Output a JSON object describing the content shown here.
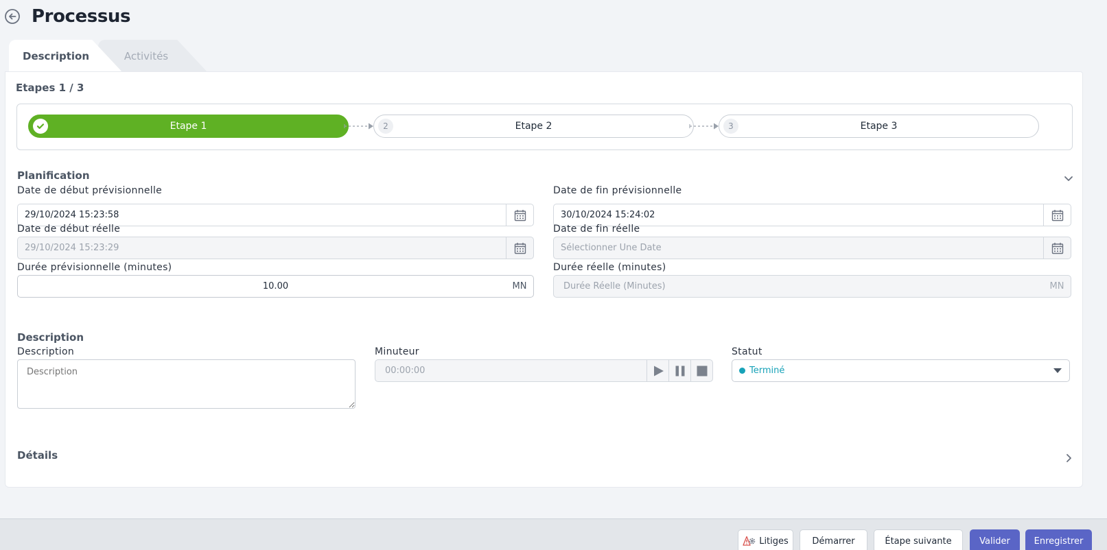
{
  "header": {
    "title": "Processus"
  },
  "tabs": [
    {
      "label": "Description"
    },
    {
      "label": "Activités"
    }
  ],
  "steps": {
    "heading": "Etapes 1 / 3",
    "items": [
      {
        "number": "1",
        "label": "Etape 1",
        "status": "done"
      },
      {
        "number": "2",
        "label": "Etape 2",
        "status": "todo"
      },
      {
        "number": "3",
        "label": "Etape 3",
        "status": "todo"
      }
    ]
  },
  "planning": {
    "heading": "Planification",
    "start_planned": {
      "label": "Date de début prévisionnelle",
      "value": "29/10/2024 15:23:58"
    },
    "end_planned": {
      "label": "Date de fin prévisionnelle",
      "value": "30/10/2024 15:24:02"
    },
    "start_actual": {
      "label": "Date de début réelle",
      "value": "29/10/2024 15:23:29"
    },
    "end_actual": {
      "label": "Date de fin réelle",
      "placeholder": "Sélectionner Une Date"
    },
    "duration_planned": {
      "label": "Durée prévisionnelle (minutes)",
      "value": "10.00",
      "unit": "MN"
    },
    "duration_actual": {
      "label": "Durée réelle (minutes)",
      "placeholder": "Durée Réelle (Minutes)",
      "unit": "MN"
    }
  },
  "description": {
    "heading": "Description",
    "field_label": "Description",
    "placeholder": "Description",
    "timer_label": "Minuteur",
    "timer_value": "00:00:00",
    "status_label": "Statut",
    "status_value": "Terminé",
    "status_color": "#17a2b8"
  },
  "details": {
    "heading": "Détails"
  },
  "footer": {
    "litiges": "Litiges",
    "start": "Démarrer",
    "next_step": "Étape suivante",
    "validate": "Valider",
    "save": "Enregistrer"
  },
  "colors": {
    "accent": "#5a65c6",
    "step_done": "#5fb124"
  }
}
